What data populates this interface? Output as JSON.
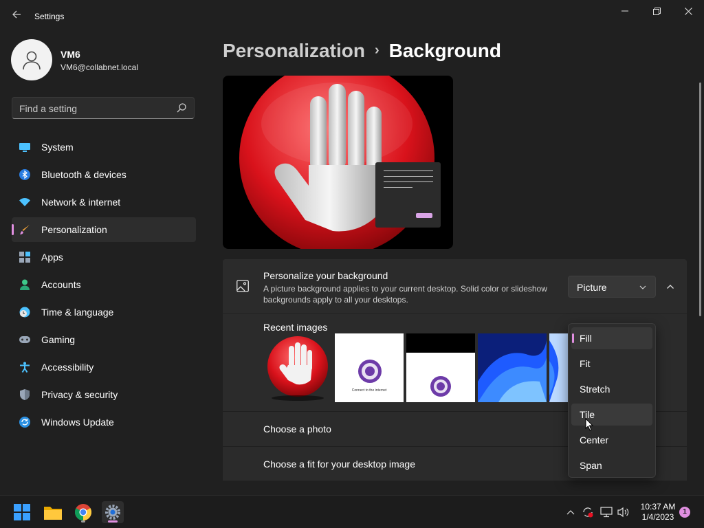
{
  "window": {
    "app_title": "Settings"
  },
  "profile": {
    "name": "VM6",
    "email": "VM6@collabnet.local"
  },
  "search": {
    "placeholder": "Find a setting"
  },
  "sidebar": {
    "items": [
      {
        "label": "System",
        "icon": "monitor-icon"
      },
      {
        "label": "Bluetooth & devices",
        "icon": "bluetooth-icon"
      },
      {
        "label": "Network & internet",
        "icon": "wifi-icon"
      },
      {
        "label": "Personalization",
        "icon": "brush-icon",
        "active": true
      },
      {
        "label": "Apps",
        "icon": "apps-icon"
      },
      {
        "label": "Accounts",
        "icon": "person-icon"
      },
      {
        "label": "Time & language",
        "icon": "globe-clock-icon"
      },
      {
        "label": "Gaming",
        "icon": "gamepad-icon"
      },
      {
        "label": "Accessibility",
        "icon": "accessibility-icon"
      },
      {
        "label": "Privacy & security",
        "icon": "shield-icon"
      },
      {
        "label": "Windows Update",
        "icon": "update-icon"
      }
    ]
  },
  "breadcrumb": {
    "parent": "Personalization",
    "separator": "›",
    "current": "Background"
  },
  "background_card": {
    "title": "Personalize your background",
    "description": "A picture background applies to your current desktop. Solid color or slideshow backgrounds apply to all your desktops.",
    "select_value": "Picture"
  },
  "recent_images": {
    "label": "Recent images",
    "thumb_connect_text": "Connect to the internet"
  },
  "rows": {
    "choose_photo": "Choose a photo",
    "choose_fit": "Choose a fit for your desktop image"
  },
  "fit_dropdown": {
    "options": [
      "Fill",
      "Fit",
      "Stretch",
      "Tile",
      "Center",
      "Span"
    ],
    "selected": "Fill",
    "hovered": "Tile"
  },
  "taskbar": {
    "time": "10:37 AM",
    "date": "1/4/2023",
    "notification_count": "1"
  },
  "colors": {
    "accent": "#e08fe0",
    "background": "#202020",
    "card": "#2b2b2b"
  }
}
